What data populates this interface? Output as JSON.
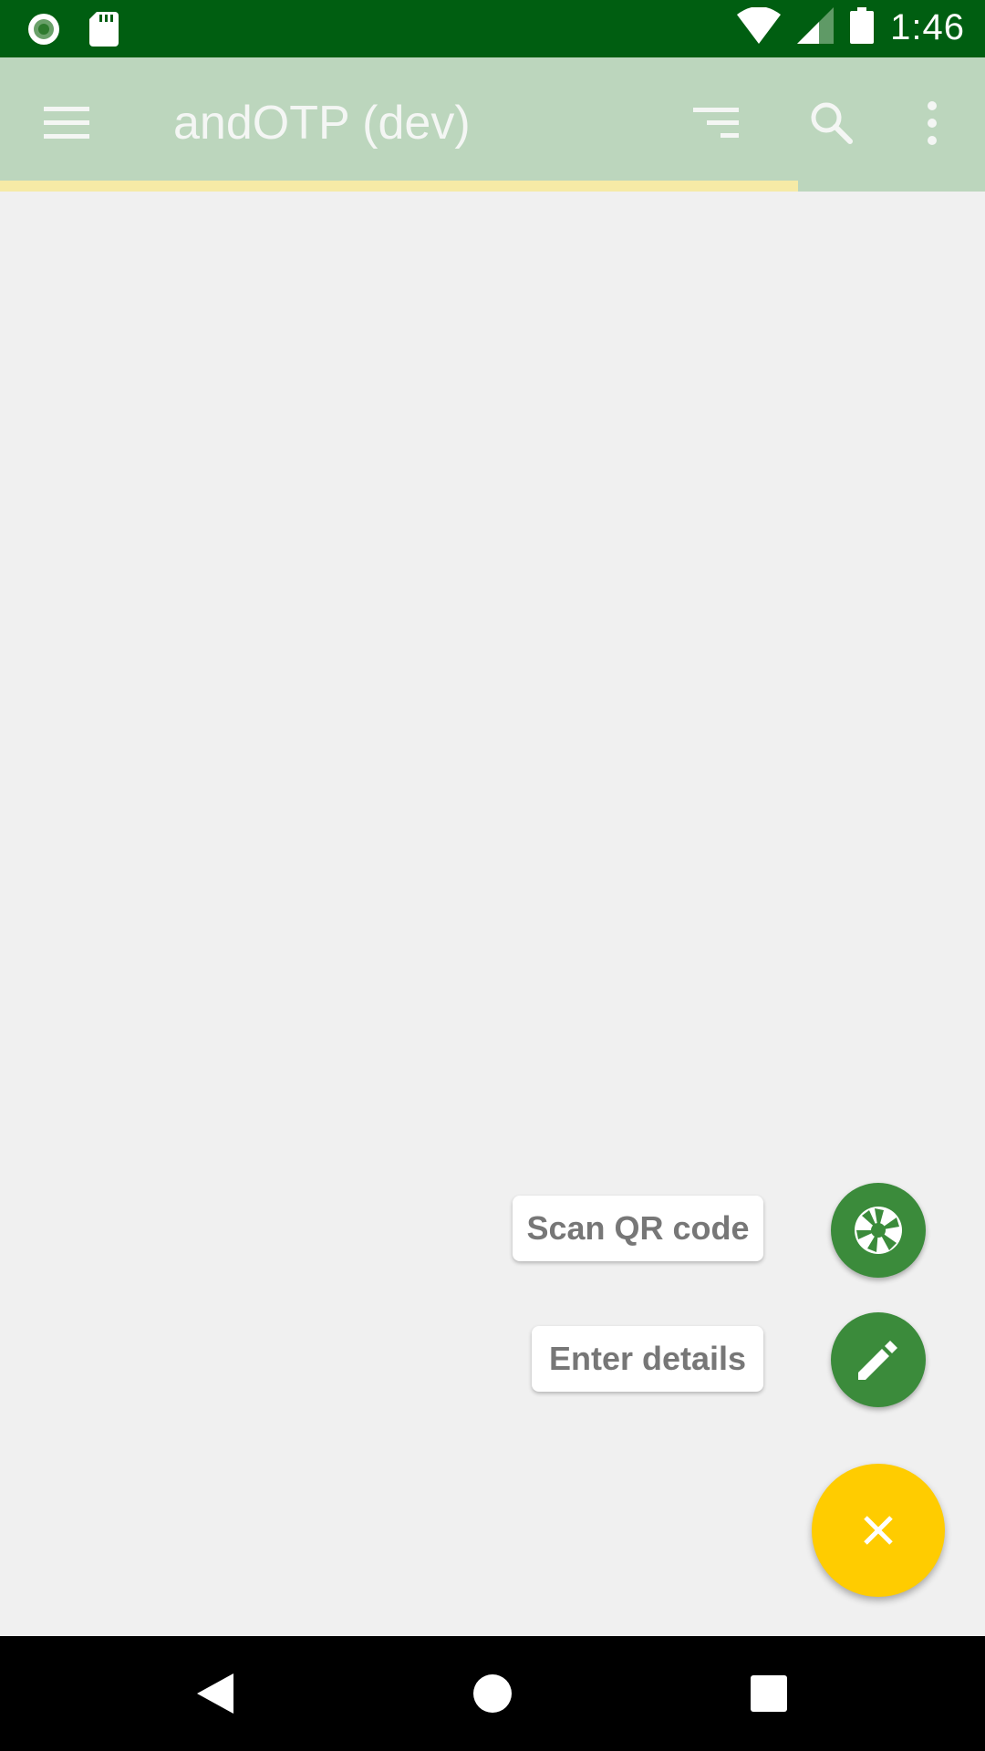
{
  "status_bar": {
    "time": "1:46",
    "icons": [
      "record-icon",
      "sd-card-icon",
      "wifi-icon",
      "signal-icon",
      "battery-icon"
    ]
  },
  "app_bar": {
    "title": "andOTP (dev)",
    "icons": [
      "menu-icon",
      "sort-icon",
      "search-icon",
      "more-vert-icon"
    ],
    "progress_fraction": 0.81,
    "background": "#bcd6bd"
  },
  "fab_menu": {
    "scan_qr_label": "Scan QR code",
    "enter_details_label": "Enter details",
    "mini_fab_color": "#3b8b3b",
    "main_fab_color": "#ffcc00",
    "icons": [
      "aperture-icon",
      "pencil-icon",
      "close-icon"
    ]
  },
  "nav_bar": {
    "icons": [
      "back-icon",
      "home-icon",
      "recents-icon"
    ]
  },
  "colors": {
    "status_bar": "#005e11",
    "progress": "#f6eaa6",
    "content_bg": "#f0f0f0"
  }
}
